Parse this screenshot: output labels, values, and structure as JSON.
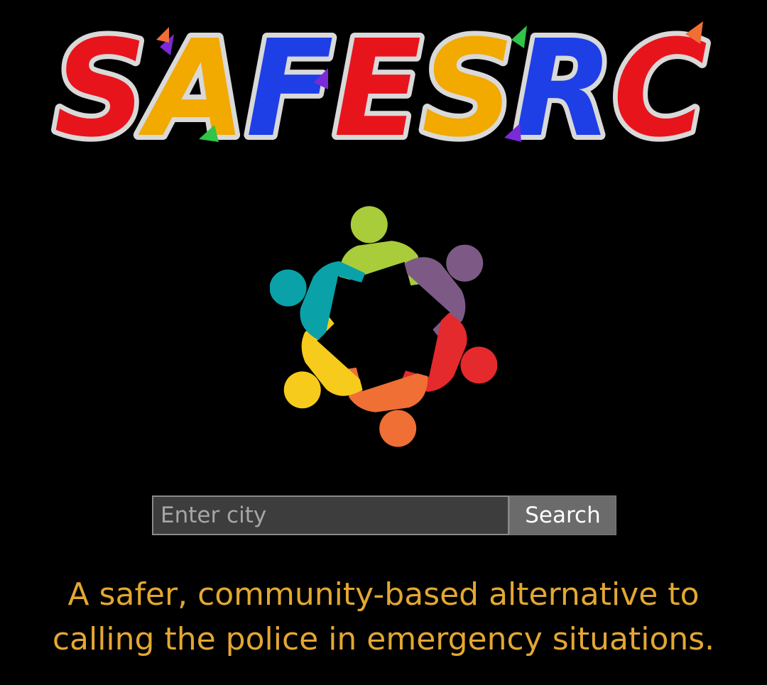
{
  "logo": {
    "text": "SAFESRC",
    "letters": [
      {
        "char": "S",
        "color": "#e8141c"
      },
      {
        "char": "A",
        "color": "#f2a900"
      },
      {
        "char": "F",
        "color": "#1e3fe6"
      },
      {
        "char": "E",
        "color": "#e8141c"
      },
      {
        "char": "S",
        "color": "#f2a900"
      },
      {
        "char": "R",
        "color": "#1e3fe6"
      },
      {
        "char": "C",
        "color": "#e8141c"
      }
    ]
  },
  "emblem": {
    "icon": "community-circle-icon",
    "colors": [
      "#a9cc3a",
      "#7d5a86",
      "#e42a2c",
      "#ef6f35",
      "#f7cb1b",
      "#0aa1a9"
    ]
  },
  "search": {
    "placeholder": "Enter city",
    "value": "",
    "button_label": "Search"
  },
  "tagline": {
    "line1": "A safer, community-based alternative to",
    "line2": "calling the police in emergency situations."
  },
  "colors": {
    "background": "#000000",
    "tagline": "#e3a732",
    "input_bg": "#3d3d3d",
    "button_bg": "#6b6b6b"
  }
}
